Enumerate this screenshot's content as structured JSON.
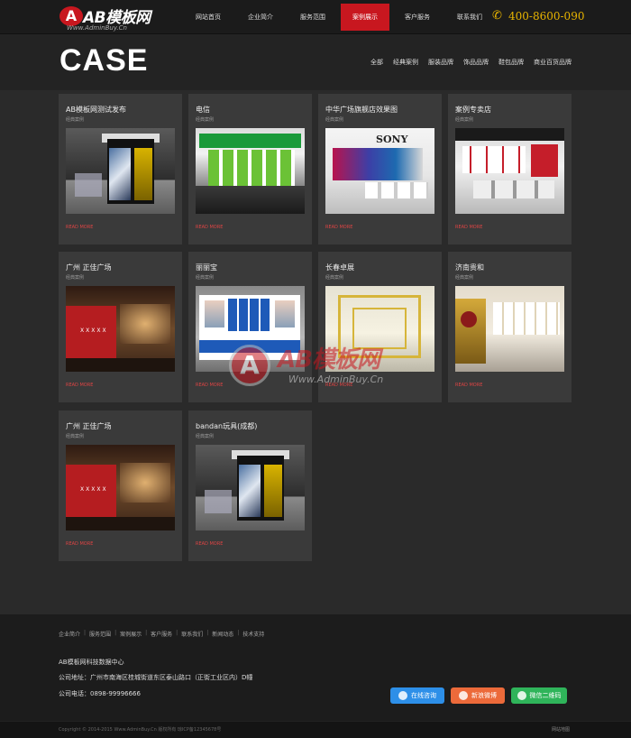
{
  "header": {
    "logo_badge": "A",
    "logo_name": "AB模板网",
    "logo_sub": "Www.AdminBuy.Cn",
    "nav": [
      {
        "label": "网站首页"
      },
      {
        "label": "企业简介"
      },
      {
        "label": "服务范围"
      },
      {
        "label": "案例展示",
        "active": true
      },
      {
        "label": "客户服务"
      },
      {
        "label": "联系我们"
      }
    ],
    "phone_icon": "phone-icon",
    "phone": "400-8600-090"
  },
  "banner": {
    "title": "CASE",
    "filters": [
      "全部",
      "经典案例",
      "服装品牌",
      "饰品品牌",
      "鞋包品牌",
      "商业百货品牌"
    ]
  },
  "cases": [
    {
      "title": "AB模板网测试发布",
      "sub": "经典案例",
      "link": "READ MORE",
      "image": "bandai"
    },
    {
      "title": "电信",
      "sub": "经典案例",
      "link": "READ MORE",
      "image": "unicom"
    },
    {
      "title": "中华广场旗舰店效果图",
      "sub": "经典案例",
      "link": "READ MORE",
      "image": "sony"
    },
    {
      "title": "案例专卖店",
      "sub": "经典案例",
      "link": "READ MORE",
      "image": "store"
    },
    {
      "title": "广州 正佳广场",
      "sub": "经典案例",
      "link": "READ MORE",
      "image": "plaza"
    },
    {
      "title": "丽丽宝",
      "sub": "经典案例",
      "link": "READ MORE",
      "image": "lili"
    },
    {
      "title": "长春卓展",
      "sub": "经典案例",
      "link": "READ MORE",
      "image": "zhuoyue"
    },
    {
      "title": "济南贵和",
      "sub": "经典案例",
      "link": "READ MORE",
      "image": "jinan"
    },
    {
      "title": "广州 正佳广场",
      "sub": "经典案例",
      "link": "READ MORE",
      "image": "plaza"
    },
    {
      "title": "bandan玩具(成都)",
      "sub": "经典案例",
      "link": "READ MORE",
      "image": "bandai"
    }
  ],
  "watermark": {
    "badge": "A",
    "name": "AB模板网",
    "sub": "Www.AdminBuy.Cn"
  },
  "footer": {
    "links": [
      "企业简介",
      "服务范围",
      "案例展示",
      "客户服务",
      "联系我们",
      "新闻动态",
      "技术支持"
    ],
    "company": "AB模板网科技数据中心",
    "address": "公司地址：广州市南海区桂城街道东区泰山路口（正街工业区内）D幢",
    "phone": "公司电话：0898-99996666",
    "qq": "在线咨询",
    "weibo": "新浪微博",
    "wechat": "微信二维码",
    "copyright": "Copyright © 2014-2015 Www.AdminBuy.Cn 版权所有 琼ICP备12345678号",
    "sitemap": "网站地图"
  }
}
